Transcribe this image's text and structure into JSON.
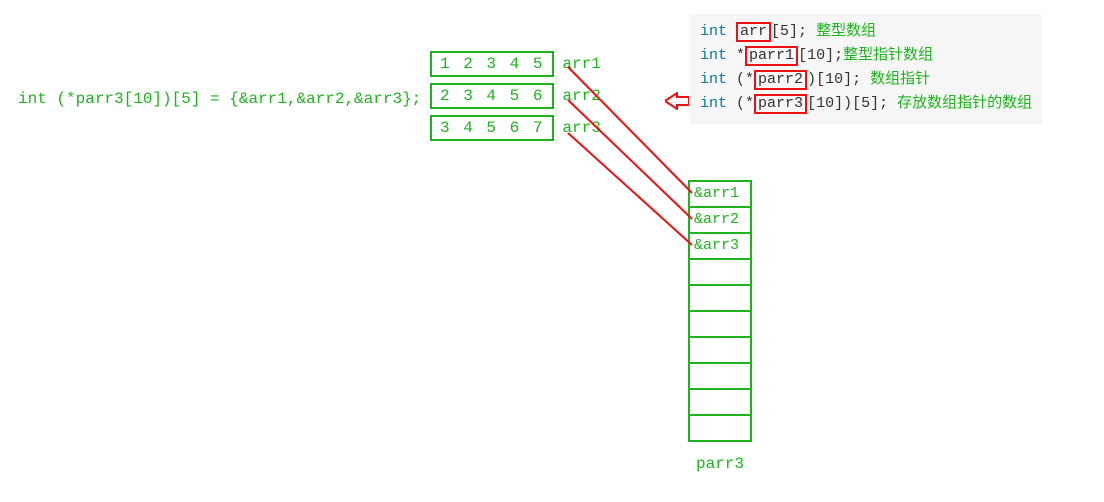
{
  "declaration_left": "int (*parr3[10])[5] = {&arr1,&arr2,&arr3};",
  "arrays": [
    {
      "values": "1 2 3 4 5",
      "label": "arr1"
    },
    {
      "values": "2 3 4 5 6",
      "label": "arr2"
    },
    {
      "values": "3 4 5 6 7",
      "label": "arr3"
    }
  ],
  "code": {
    "l1": {
      "kw": "int",
      "boxed": "arr",
      "rest": "[5];",
      "comment": "整型数组"
    },
    "l2": {
      "kw": "int",
      "star": "*",
      "boxed": "parr1",
      "rest": "[10];",
      "comment": "整型指针数组"
    },
    "l3": {
      "kw": "int",
      "open": "(*",
      "boxed": "parr2",
      "close": ")[10];",
      "comment": "数组指针"
    },
    "l4": {
      "kw": "int",
      "open": "(*",
      "boxed": "parr3",
      "close": "[10])[5];",
      "comment": "存放数组指针的数组"
    }
  },
  "parr3": {
    "label": "parr3",
    "cells": [
      "&arr1",
      "&arr2",
      "&arr3",
      "",
      "",
      "",
      "",
      "",
      "",
      ""
    ]
  },
  "colors": {
    "green": "#1db51d",
    "red": "#e11"
  }
}
